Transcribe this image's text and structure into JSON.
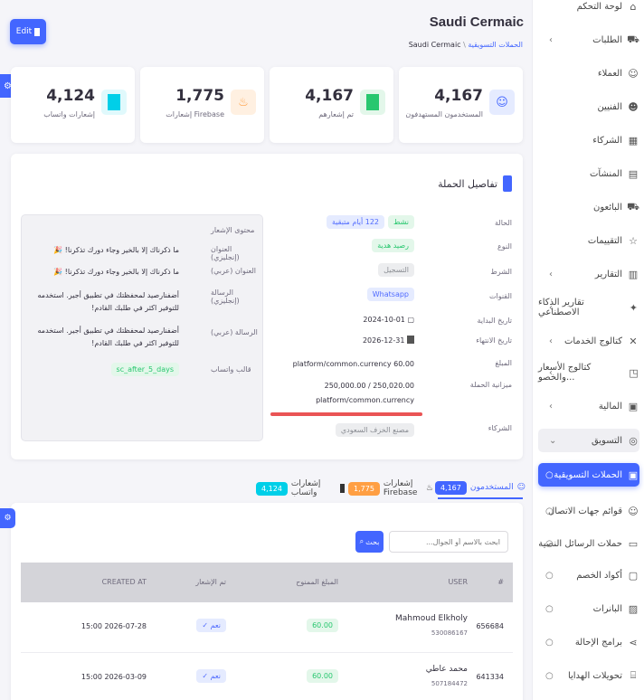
{
  "header": {
    "edit_label": "Edit",
    "company": "Saudi Cermaic",
    "breadcrumb_parent": "Saudi Cermaic",
    "breadcrumb_sep": "\\",
    "breadcrumb_current": "الحملات التسويقية"
  },
  "stats": [
    {
      "value": "4,167",
      "label": "المستخدمون المستهدفون"
    },
    {
      "value": "4,167",
      "label": "تم إشعارهم"
    },
    {
      "value": "1,775",
      "label": "إشعارات Firebase"
    },
    {
      "value": "4,124",
      "label": "إشعارات واتساب"
    }
  ],
  "details": {
    "title": "تفاصيل الحملة",
    "status_label": "الحالة",
    "status_value": "نشط",
    "days_left": "122 أيام متبقية",
    "type_label": "النوع",
    "type_value": "رصيد هدية",
    "condition_label": "الشرط",
    "condition_value": "التسجيل",
    "channels_label": "القنوات",
    "channels_value": "Whatsapp",
    "start_label": "تاريخ البداية",
    "start_value": "2024-10-01",
    "end_label": "تاريخ الانتهاء",
    "end_value": "2026-12-31",
    "amount_label": "المبلغ",
    "amount_value": "platform/common.currency 60.00",
    "budget_label": "ميزانية الحملة",
    "budget_value": "250,000.00 / 250,020.00",
    "budget_currency": "platform/common.currency",
    "budget_progress": 0.9999,
    "partners_label": "الشركاء",
    "partners_value": "مصنع الخزف السعودي"
  },
  "notification": {
    "heading": "محتوى الإشعار",
    "title_en_label": "العنوان (إنجليزي)",
    "title_en_value": "ما ذكرناك إلا بالخير وجاء دورك تذكرنا! 🎉",
    "title_ar_label": "العنوان (عربي)",
    "title_ar_value": "ما ذكرناك إلا بالخير وجاء دورك تذكرنا! 🎉",
    "msg_en_label": "الرسالة (إنجليزي)",
    "msg_en_value": "أضفنارصيد لمحفظتك في تطبيق أجير. استخدمه للتوفير اكثر في طلبك القادم!",
    "msg_ar_label": "الرسالة (عربي)",
    "msg_ar_value": "أضفنارصيد لمحفظتك في تطبيق أجير. استخدمه للتوفير اكثر في طلبك القادم!",
    "template_label": "قالب واتساب",
    "template_value": "sc_after_5_days"
  },
  "tabs": [
    {
      "label": "المستخدمون",
      "count": "4,167"
    },
    {
      "label": "إشعارات Firebase",
      "count": "1,775"
    },
    {
      "label": "إشعارات واتساب",
      "count": "4,124"
    }
  ],
  "search": {
    "placeholder": "ابحث بالاسم أو الجوال...",
    "button": "بحث"
  },
  "table": {
    "columns": [
      "#",
      "USER",
      "المبلغ الممنوح",
      "تم الإشعار",
      "CREATED AT"
    ],
    "rows": [
      {
        "id": "656684",
        "name": "Mahmoud Elkholy",
        "phone": "530086167",
        "amount": "60.00",
        "notified": "نعم",
        "created": "15:00 2026-07-28"
      },
      {
        "id": "641334",
        "name": "محمد عاطي",
        "phone": "507184472",
        "amount": "60.00",
        "notified": "نعم",
        "created": "15:00 2026-03-09"
      }
    ]
  },
  "sidebar": {
    "items": [
      {
        "label": "لوحة التحكم",
        "icon": "home-icon"
      },
      {
        "label": "الطلبات",
        "icon": "cart-icon"
      },
      {
        "label": "العملاء",
        "icon": "users-icon"
      },
      {
        "label": "الفنيين",
        "icon": "user-icon"
      },
      {
        "label": "الشركاء",
        "icon": "building-icon"
      },
      {
        "label": "المنشآت",
        "icon": "office-icon"
      },
      {
        "label": "البائعون",
        "icon": "truck-icon"
      },
      {
        "label": "التقييمات",
        "icon": "star-icon"
      },
      {
        "label": "التقارير",
        "icon": "chart-icon"
      },
      {
        "label": "تقارير الذكاء الاصطناعي",
        "icon": "sparkle-icon"
      },
      {
        "label": "كتالوج الخدمات",
        "icon": "tools-icon"
      },
      {
        "label": "كتالوج الأسعار والخصو...",
        "icon": "tag-icon"
      },
      {
        "label": "المالية",
        "icon": "wallet-icon"
      },
      {
        "label": "التسويق",
        "icon": "target-icon"
      },
      {
        "label": "الحملات التسويقية",
        "icon": "ad-icon"
      },
      {
        "label": "قوائم جهات الاتصال",
        "icon": "contacts-icon"
      },
      {
        "label": "حملات الرسائل النصية",
        "icon": "message-icon"
      },
      {
        "label": "أكواد الخصم",
        "icon": "ticket-icon"
      },
      {
        "label": "البانرات",
        "icon": "image-icon"
      },
      {
        "label": "برامج الإحالة",
        "icon": "share-icon"
      },
      {
        "label": "تحويلات الهدايا",
        "icon": "gift-icon"
      }
    ]
  },
  "colors": {
    "primary": "#4366ff",
    "success": "#28c76f",
    "warning": "#ff9f43",
    "info": "#00cfe8",
    "danger": "#ea5455"
  }
}
